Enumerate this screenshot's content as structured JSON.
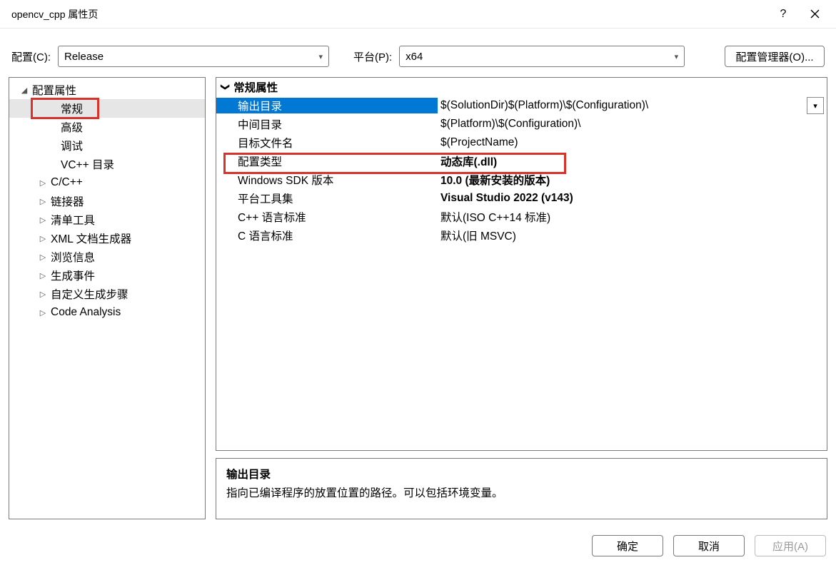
{
  "title": "opencv_cpp 属性页",
  "configRow": {
    "configLabel": "配置(C):",
    "configValue": "Release",
    "platformLabel": "平台(P):",
    "platformValue": "x64",
    "managerBtn": "配置管理器(O)..."
  },
  "tree": [
    {
      "label": "配置属性",
      "level": 0,
      "expanded": true
    },
    {
      "label": "常规",
      "level": 1,
      "selected": true,
      "highlight": true
    },
    {
      "label": "高级",
      "level": 1
    },
    {
      "label": "调试",
      "level": 1
    },
    {
      "label": "VC++ 目录",
      "level": 1
    },
    {
      "label": "C/C++",
      "level": 1,
      "hasChildren": true
    },
    {
      "label": "链接器",
      "level": 1,
      "hasChildren": true
    },
    {
      "label": "清单工具",
      "level": 1,
      "hasChildren": true
    },
    {
      "label": "XML 文档生成器",
      "level": 1,
      "hasChildren": true
    },
    {
      "label": "浏览信息",
      "level": 1,
      "hasChildren": true
    },
    {
      "label": "生成事件",
      "level": 1,
      "hasChildren": true
    },
    {
      "label": "自定义生成步骤",
      "level": 1,
      "hasChildren": true
    },
    {
      "label": "Code Analysis",
      "level": 1,
      "hasChildren": true
    }
  ],
  "propGroup": "常规属性",
  "props": [
    {
      "name": "输出目录",
      "value": "$(SolutionDir)$(Platform)\\$(Configuration)\\",
      "selected": true,
      "dropdown": true
    },
    {
      "name": "中间目录",
      "value": "$(Platform)\\$(Configuration)\\"
    },
    {
      "name": "目标文件名",
      "value": "$(ProjectName)"
    },
    {
      "name": "配置类型",
      "value": "动态库(.dll)",
      "bold": true,
      "highlight": true
    },
    {
      "name": "Windows SDK 版本",
      "value": "10.0 (最新安装的版本)",
      "bold": true
    },
    {
      "name": "平台工具集",
      "value": "Visual Studio 2022 (v143)",
      "bold": true
    },
    {
      "name": "C++ 语言标准",
      "value": "默认(ISO C++14 标准)"
    },
    {
      "name": "C 语言标准",
      "value": "默认(旧 MSVC)"
    }
  ],
  "desc": {
    "title": "输出目录",
    "text": "指向已编译程序的放置位置的路径。可以包括环境变量。"
  },
  "footer": {
    "ok": "确定",
    "cancel": "取消",
    "apply": "应用(A)"
  }
}
